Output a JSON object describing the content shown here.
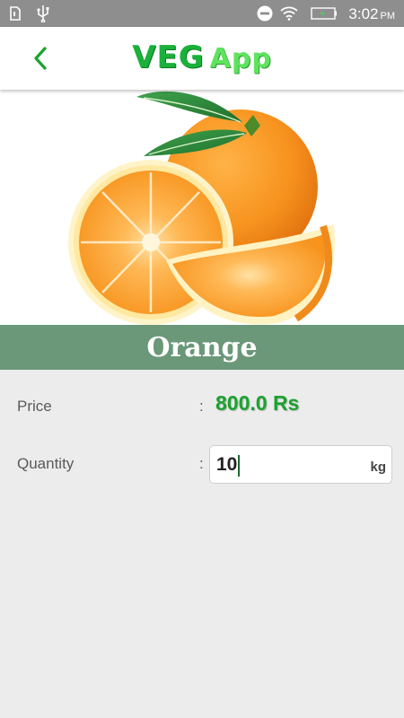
{
  "status_bar": {
    "time": "3:02",
    "ampm": "PM",
    "icons": [
      "sim-icon",
      "usb-icon",
      "do-not-disturb-icon",
      "wifi-icon",
      "battery-icon"
    ]
  },
  "app_bar": {
    "title_part1": "VEG",
    "title_part2": "App",
    "back_icon": "chevron-left-icon",
    "accent": "#1ab13a"
  },
  "product": {
    "image": "orange-fruit-image",
    "name": "Orange",
    "band_color": "#6a9879"
  },
  "details": {
    "price_label": "Price",
    "price_colon": ":",
    "price_value": "800.0 Rs",
    "quantity_label": "Quantity",
    "quantity_colon": ":",
    "quantity_value": "10",
    "quantity_unit": "kg"
  }
}
